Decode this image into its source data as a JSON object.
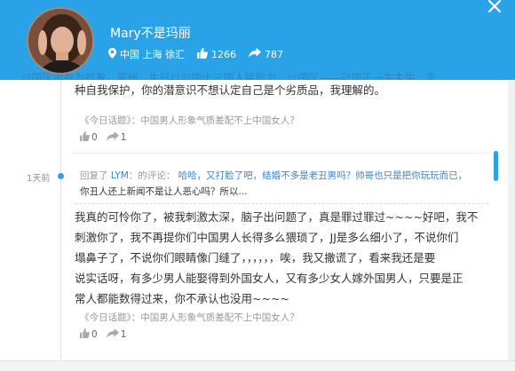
{
  "header": {
    "user_name": "Mary不是玛丽",
    "location": "中国 上海 徐汇",
    "likes": "1266",
    "shares": "787",
    "faded_text": "...、以国区国有为前差。亚州，生日以与国士三国人民际力，以国区——己国正一生主生，定"
  },
  "posts": [
    {
      "text_lines": [
        "种自我保护，你的潜意识不想认定自己是个劣质品，我理解的。"
      ],
      "topic": "《今日话题》：中国男人形象气质差配不上中国女人？",
      "likes": "0",
      "shares": "1"
    },
    {
      "time": "1天前",
      "reply_prefix": "回复了",
      "reply_user": "LYM",
      "reply_mid": "：的评论：",
      "reply_line1": "哈哈，又打脸了吧，结婚不多是老丑男吗？帅哥也只是把你玩玩而已，",
      "reply_line2": "你丑人还上新闻不是让人恶心吗？所以...",
      "text_lines": [
        "我真的可怜你了，被我刺激太深，脑子出问题了，真是罪过罪过~~~~好吧，我不",
        "刺激你了，我不再提你们中国男人长得多么猥琐了，JJ是多么细小了，不说你们",
        "塌鼻子了，不说你们眼睛像门缝了，，，，，，唉，我又撒谎了，看来我还是要",
        "说实话呀，有多少男人能娶得到外国女人，又有多少女人嫁外国男人，只要是正",
        "常人都能数得过来，你不承认也没用~~~~"
      ],
      "topic": "《今日话题》：中国男人形象气质差配不上中国女人？",
      "likes": "0",
      "shares": "1"
    }
  ],
  "icons": {
    "close": "close-icon",
    "location": "location-pin-icon",
    "like": "thumbs-up-icon",
    "share": "share-arrow-icon"
  },
  "colors": {
    "header": "#2aa2e7",
    "link": "#3a86c8",
    "accent": "#2aa2e7"
  }
}
